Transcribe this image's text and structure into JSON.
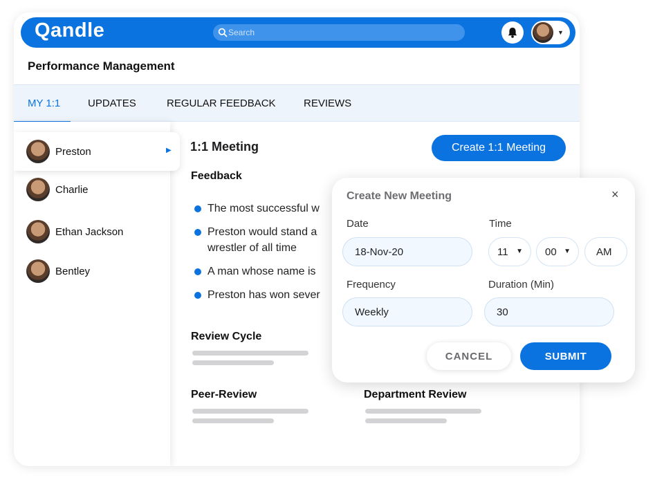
{
  "header": {
    "logo": "Qandle",
    "search_placeholder": "Search"
  },
  "page": {
    "title": "Performance Management"
  },
  "tabs": [
    {
      "label": "MY 1:1",
      "active": true
    },
    {
      "label": "UPDATES"
    },
    {
      "label": "REGULAR FEEDBACK"
    },
    {
      "label": "REVIEWS"
    }
  ],
  "people": [
    {
      "name": "Preston",
      "selected": true
    },
    {
      "name": "Charlie"
    },
    {
      "name": "Ethan Jackson"
    },
    {
      "name": "Bentley"
    }
  ],
  "main": {
    "title": "1:1 Meeting",
    "create_button": "Create 1:1 Meeting",
    "feedback_heading": "Feedback",
    "feedback_items": [
      "The most successful w",
      "Preston would stand a",
      "wrestler of all time",
      "A man whose name is",
      "Preston has won sever"
    ],
    "review_cycle": "Review Cycle",
    "peer_review": "Peer-Review",
    "department_review": "Department Review"
  },
  "modal": {
    "title": "Create New Meeting",
    "close": "×",
    "date_label": "Date",
    "date_value": "18-Nov-20",
    "time_label": "Time",
    "hour": "11",
    "minute": "00",
    "ampm": "AM",
    "frequency_label": "Frequency",
    "frequency_value": "Weekly",
    "duration_label": "Duration (Min)",
    "duration_value": "30",
    "cancel": "CANCEL",
    "submit": "SUBMIT"
  },
  "colors": {
    "accent": "#0b73df",
    "tab_bg": "#eef4fb"
  }
}
